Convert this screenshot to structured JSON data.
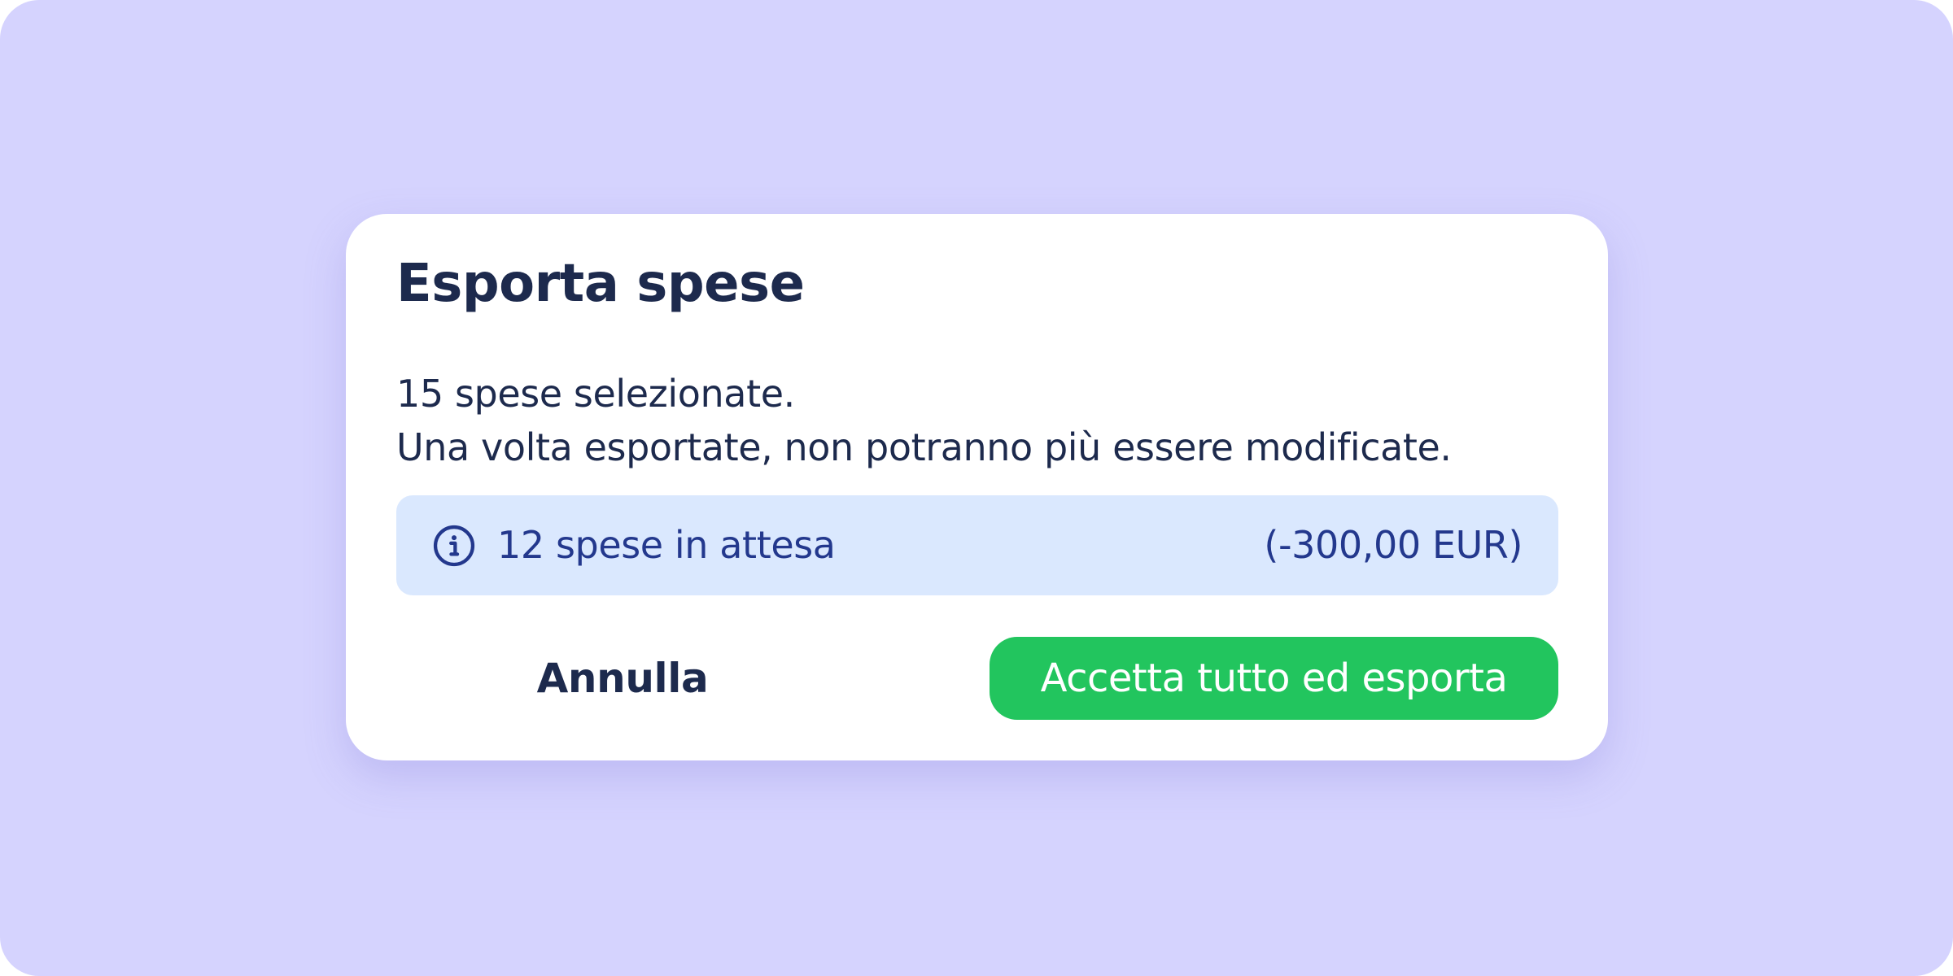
{
  "dialog": {
    "title": "Esporta spese",
    "description": {
      "line1": "15 spese selezionate.",
      "line2": "Una volta esportate, non potranno più essere modificate."
    },
    "info": {
      "icon": "info-icon",
      "text": "12 spese in attesa",
      "amount": "(-300,00 EUR)"
    },
    "buttons": {
      "cancel_label": "Annulla",
      "accept_label": "Accetta tutto ed esporta"
    }
  },
  "colors": {
    "background": "#d5d3fe",
    "dialog": "#ffffff",
    "text_primary": "#1d2a4d",
    "info_background": "#dae8fe",
    "info_text": "#23388d",
    "accept_button": "#22c55e"
  }
}
